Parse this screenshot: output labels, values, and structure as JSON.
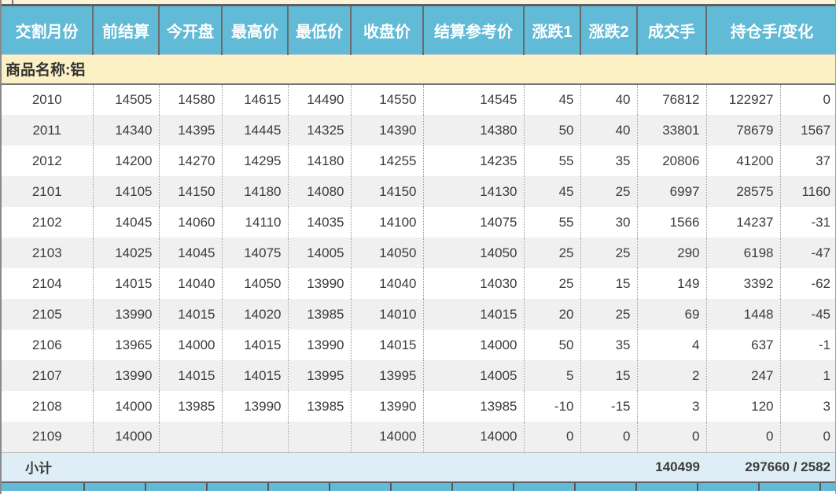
{
  "table": {
    "commodity_label": "商品名称:铝",
    "columns": [
      {
        "label": "交割月份"
      },
      {
        "label": "前结算"
      },
      {
        "label": "今开盘"
      },
      {
        "label": "最高价"
      },
      {
        "label": "最低价"
      },
      {
        "label": "收盘价"
      },
      {
        "label": "结算参考价"
      },
      {
        "label": "涨跌1"
      },
      {
        "label": "涨跌2"
      },
      {
        "label": "成交手"
      },
      {
        "label": "持仓手/变化"
      }
    ],
    "rows": [
      {
        "month": "2010",
        "prev_settle": "14505",
        "open": "14580",
        "high": "14615",
        "low": "14490",
        "close": "14550",
        "settle_ref": "14545",
        "change1": "45",
        "change2": "40",
        "volume": "76812",
        "open_interest": "122927",
        "oi_change": "0"
      },
      {
        "month": "2011",
        "prev_settle": "14340",
        "open": "14395",
        "high": "14445",
        "low": "14325",
        "close": "14390",
        "settle_ref": "14380",
        "change1": "50",
        "change2": "40",
        "volume": "33801",
        "open_interest": "78679",
        "oi_change": "1567"
      },
      {
        "month": "2012",
        "prev_settle": "14200",
        "open": "14270",
        "high": "14295",
        "low": "14180",
        "close": "14255",
        "settle_ref": "14235",
        "change1": "55",
        "change2": "35",
        "volume": "20806",
        "open_interest": "41200",
        "oi_change": "37"
      },
      {
        "month": "2101",
        "prev_settle": "14105",
        "open": "14150",
        "high": "14180",
        "low": "14080",
        "close": "14150",
        "settle_ref": "14130",
        "change1": "45",
        "change2": "25",
        "volume": "6997",
        "open_interest": "28575",
        "oi_change": "1160"
      },
      {
        "month": "2102",
        "prev_settle": "14045",
        "open": "14060",
        "high": "14110",
        "low": "14035",
        "close": "14100",
        "settle_ref": "14075",
        "change1": "55",
        "change2": "30",
        "volume": "1566",
        "open_interest": "14237",
        "oi_change": "-31"
      },
      {
        "month": "2103",
        "prev_settle": "14025",
        "open": "14045",
        "high": "14075",
        "low": "14005",
        "close": "14050",
        "settle_ref": "14050",
        "change1": "25",
        "change2": "25",
        "volume": "290",
        "open_interest": "6198",
        "oi_change": "-47"
      },
      {
        "month": "2104",
        "prev_settle": "14015",
        "open": "14040",
        "high": "14050",
        "low": "13990",
        "close": "14040",
        "settle_ref": "14030",
        "change1": "25",
        "change2": "15",
        "volume": "149",
        "open_interest": "3392",
        "oi_change": "-62"
      },
      {
        "month": "2105",
        "prev_settle": "13990",
        "open": "14015",
        "high": "14020",
        "low": "13985",
        "close": "14010",
        "settle_ref": "14015",
        "change1": "20",
        "change2": "25",
        "volume": "69",
        "open_interest": "1448",
        "oi_change": "-45"
      },
      {
        "month": "2106",
        "prev_settle": "13965",
        "open": "14000",
        "high": "14015",
        "low": "13990",
        "close": "14015",
        "settle_ref": "14000",
        "change1": "50",
        "change2": "35",
        "volume": "4",
        "open_interest": "637",
        "oi_change": "-1"
      },
      {
        "month": "2107",
        "prev_settle": "13990",
        "open": "14015",
        "high": "14015",
        "low": "13995",
        "close": "13995",
        "settle_ref": "14005",
        "change1": "5",
        "change2": "15",
        "volume": "2",
        "open_interest": "247",
        "oi_change": "1"
      },
      {
        "month": "2108",
        "prev_settle": "14000",
        "open": "13985",
        "high": "13990",
        "low": "13985",
        "close": "13990",
        "settle_ref": "13985",
        "change1": "-10",
        "change2": "-15",
        "volume": "3",
        "open_interest": "120",
        "oi_change": "3"
      },
      {
        "month": "2109",
        "prev_settle": "14000",
        "open": "",
        "high": "",
        "low": "",
        "close": "14000",
        "settle_ref": "14000",
        "change1": "0",
        "change2": "0",
        "volume": "0",
        "open_interest": "0",
        "oi_change": "0"
      }
    ],
    "subtotal": {
      "label": "小计",
      "volume": "140499",
      "open_interest_change": "297660 / 2582"
    }
  },
  "colors": {
    "header_bg": "#61BAD6",
    "header_text": "#FFFFFF",
    "strip_yellow": "#FBF4D7",
    "commodity_bg": "#FBF1C5",
    "row_bg": "#FFFFFF",
    "row_alt_bg": "#F0F0F0",
    "subtotal_bg": "#DFEEF6",
    "border_dark": "#666666",
    "text": "#3C3C3C"
  }
}
